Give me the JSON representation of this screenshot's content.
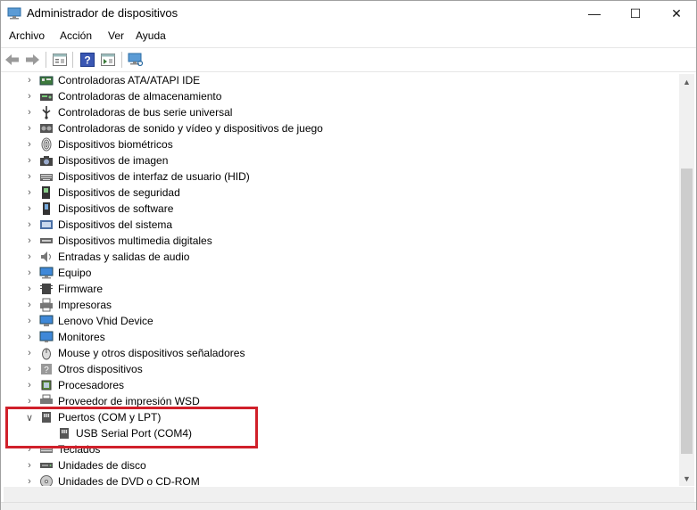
{
  "window": {
    "title": "Administrador de dispositivos",
    "controls": {
      "minimize": "—",
      "maximize": "☐",
      "close": "✕"
    }
  },
  "menu": [
    "Archivo",
    "Acción",
    "Ver",
    "Ayuda"
  ],
  "toolbar": [
    "back-arrow-icon",
    "forward-arrow-icon",
    "properties-icon",
    "help-icon",
    "show-hidden-icon",
    "scan-hardware-icon"
  ],
  "tree": {
    "items": [
      {
        "label": "Controladoras ATA/ATAPI IDE",
        "icon": "ide-controller-icon",
        "expanded": false
      },
      {
        "label": "Controladoras de almacenamiento",
        "icon": "storage-controller-icon",
        "expanded": false
      },
      {
        "label": "Controladoras de bus serie universal",
        "icon": "usb-controller-icon",
        "expanded": false
      },
      {
        "label": "Controladoras de sonido y vídeo y dispositivos de juego",
        "icon": "sound-controller-icon",
        "expanded": false
      },
      {
        "label": "Dispositivos biométricos",
        "icon": "fingerprint-icon",
        "expanded": false
      },
      {
        "label": "Dispositivos de imagen",
        "icon": "camera-icon",
        "expanded": false
      },
      {
        "label": "Dispositivos de interfaz de usuario (HID)",
        "icon": "hid-keyboard-icon",
        "expanded": false
      },
      {
        "label": "Dispositivos de seguridad",
        "icon": "security-device-icon",
        "expanded": false
      },
      {
        "label": "Dispositivos de software",
        "icon": "software-device-icon",
        "expanded": false
      },
      {
        "label": "Dispositivos del sistema",
        "icon": "system-device-icon",
        "expanded": false
      },
      {
        "label": "Dispositivos multimedia digitales",
        "icon": "multimedia-device-icon",
        "expanded": false
      },
      {
        "label": "Entradas y salidas de audio",
        "icon": "speaker-icon",
        "expanded": false
      },
      {
        "label": "Equipo",
        "icon": "computer-icon",
        "expanded": false
      },
      {
        "label": "Firmware",
        "icon": "firmware-icon",
        "expanded": false
      },
      {
        "label": "Impresoras",
        "icon": "printer-icon",
        "expanded": false
      },
      {
        "label": "Lenovo Vhid Device",
        "icon": "lenovo-device-icon",
        "expanded": false
      },
      {
        "label": "Monitores",
        "icon": "monitor-icon",
        "expanded": false
      },
      {
        "label": "Mouse y otros dispositivos señaladores",
        "icon": "mouse-icon",
        "expanded": false
      },
      {
        "label": "Otros dispositivos",
        "icon": "unknown-device-icon",
        "expanded": false
      },
      {
        "label": "Procesadores",
        "icon": "processor-icon",
        "expanded": false
      },
      {
        "label": "Proveedor de impresión WSD",
        "icon": "wsd-printer-icon",
        "expanded": false
      },
      {
        "label": "Puertos (COM y LPT)",
        "icon": "port-icon",
        "expanded": true,
        "children": [
          {
            "label": "USB Serial Port (COM4)",
            "icon": "port-icon"
          }
        ]
      },
      {
        "label": "Teclados",
        "icon": "keyboard-icon",
        "expanded": false
      },
      {
        "label": "Unidades de disco",
        "icon": "disk-drive-icon",
        "expanded": false
      },
      {
        "label": "Unidades de DVD o CD-ROM",
        "icon": "dvd-drive-icon",
        "expanded": false
      }
    ]
  },
  "colors": {
    "highlight_border": "#d0202a",
    "chevron": "#555555"
  }
}
